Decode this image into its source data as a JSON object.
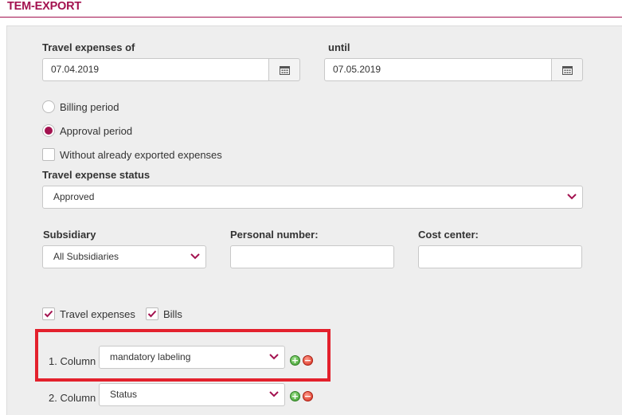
{
  "header": {
    "title": "TEM-EXPORT"
  },
  "form": {
    "from_label": "Travel expenses  of",
    "from_value": "07.04.2019",
    "until_label": "until",
    "until_value": "07.05.2019",
    "period_options": [
      {
        "label": "Billing period",
        "checked": false
      },
      {
        "label": "Approval period",
        "checked": true
      }
    ],
    "without_exported_label": "Without already exported expenses",
    "status_label": "Travel expense status",
    "status_value": "Approved",
    "subsidiary_label": "Subsidiary",
    "subsidiary_value": "All Subsidiaries",
    "personal_number_label": "Personal number:",
    "personal_number_value": "",
    "cost_center_label": "Cost center:",
    "cost_center_value": "",
    "type_checks": [
      {
        "label": "Travel expenses",
        "checked": true
      },
      {
        "label": "Bills",
        "checked": true
      }
    ],
    "columns": [
      {
        "label": "1. Column",
        "value": "mandatory labeling"
      },
      {
        "label": "2. Column",
        "value": "Status"
      }
    ]
  },
  "colors": {
    "accent": "#a3124f",
    "highlight": "#e3202c"
  },
  "icons": [
    "calendar-icon",
    "chevron-down-icon",
    "check-icon",
    "add-icon",
    "remove-icon"
  ]
}
